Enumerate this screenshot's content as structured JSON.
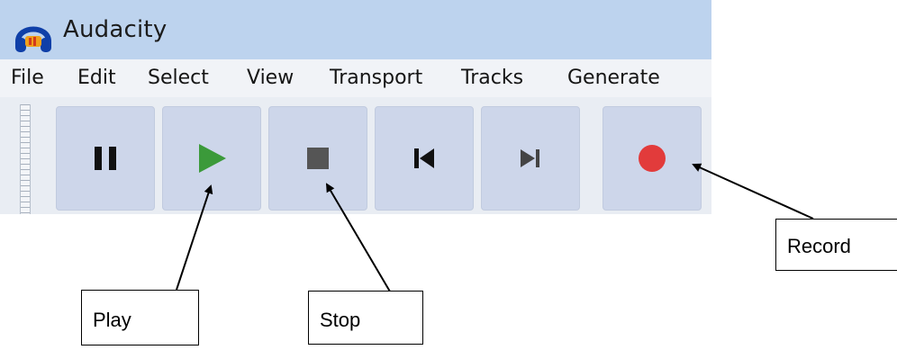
{
  "window": {
    "title": "Audacity"
  },
  "menu": [
    "File",
    "Edit",
    "Select",
    "View",
    "Transport",
    "Tracks",
    "Generate"
  ],
  "toolbar": {
    "buttons": [
      {
        "icon": "pause-icon"
      },
      {
        "icon": "play-icon"
      },
      {
        "icon": "stop-icon"
      },
      {
        "icon": "skip-to-start-icon"
      },
      {
        "icon": "skip-to-end-icon"
      },
      {
        "icon": "record-icon"
      }
    ]
  },
  "callouts": {
    "play": "Play",
    "stop": "Stop",
    "record": "Record"
  },
  "colors": {
    "titlebar": "#bdd3ee",
    "menubar": "#f1f3f7",
    "toolbar": "#e9edf3",
    "button": "#cdd6ea",
    "play": "#3b9a3a",
    "stop": "#555555",
    "record": "#e23b3b"
  }
}
